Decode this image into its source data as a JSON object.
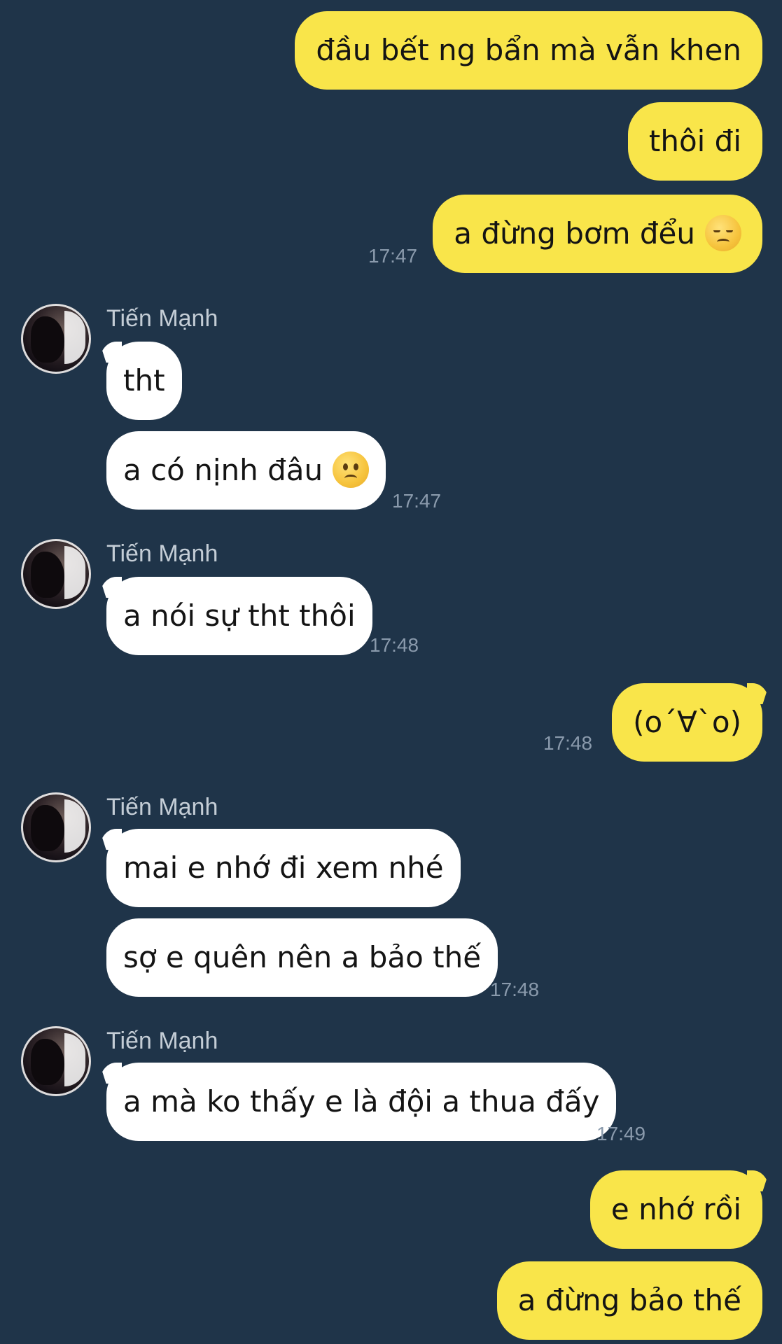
{
  "contact": {
    "name": "Tiến Mạnh"
  },
  "messages": [
    {
      "text": "đầu bết ng bẩn mà vẫn khen"
    },
    {
      "text": "thôi đi"
    },
    {
      "text": "a đừng bơm đểu",
      "emoji": "pensive-face-icon",
      "time": "17:47"
    },
    {
      "text": "tht"
    },
    {
      "text": "a có nịnh đâu",
      "emoji": "slightly-frowning-face-icon",
      "time": "17:47"
    },
    {
      "text": "a nói sự tht thôi",
      "time": "17:48"
    },
    {
      "text": "(o´∀`o)",
      "time": "17:48"
    },
    {
      "text": "mai e nhớ đi xem nhé"
    },
    {
      "text": "sợ e quên nên a bảo thế",
      "time": "17:48"
    },
    {
      "text": "a mà ko thấy e là đội a thua đấy",
      "time": "17:49"
    },
    {
      "text": "e nhớ rồi"
    },
    {
      "text": "a đừng bảo thế"
    }
  ],
  "colors": {
    "background": "#1f3449",
    "outgoing_bubble": "#f9e54a",
    "incoming_bubble": "#ffffff",
    "timestamp": "#8a9aac",
    "sender_name": "#c4cdd6"
  }
}
